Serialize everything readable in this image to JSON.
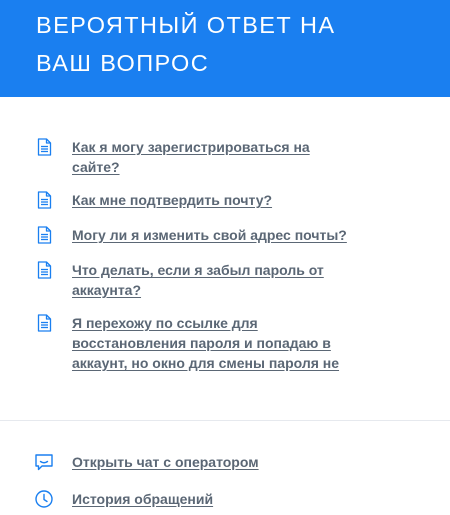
{
  "header": {
    "title": "ВЕРОЯТНЫЙ ОТВЕТ НА ВАШ ВОПРОС"
  },
  "faq": {
    "items": [
      {
        "label": "Как я могу зарегистрироваться на сайте?",
        "icon": "document-icon"
      },
      {
        "label": "Как мне подтвердить почту?",
        "icon": "document-icon"
      },
      {
        "label": "Могу ли я изменить свой адрес почты?",
        "icon": "document-icon"
      },
      {
        "label": "Что делать, если я забыл пароль от аккаунта?",
        "icon": "document-icon"
      },
      {
        "label": "Я перехожу по ссылке для восстановления пароля и попадаю в аккаунт, но окно для смены пароля не",
        "icon": "document-icon"
      }
    ]
  },
  "actions": {
    "chat_label": "Открыть чат с оператором",
    "chat_icon": "chat-icon",
    "history_label": "История обращений",
    "history_icon": "clock-icon"
  },
  "colors": {
    "header_bg": "#1a7ff0",
    "link_text": "#5b6775",
    "icon": "#1a7ff0"
  }
}
